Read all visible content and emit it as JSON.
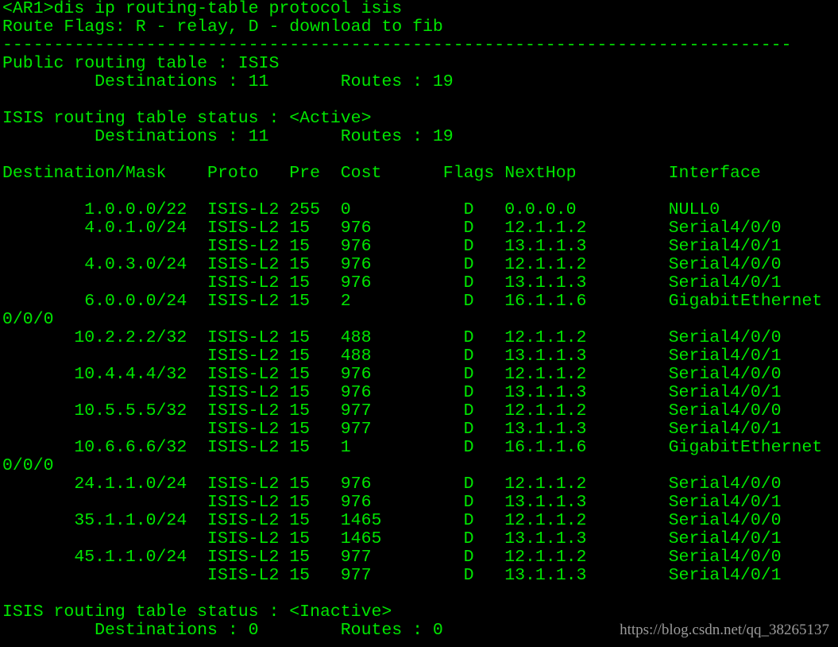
{
  "colors": {
    "background": "#000000",
    "text": "#00e600",
    "watermark": "#9a9a9a"
  },
  "terminal": {
    "lines": [
      "<AR1>dis ip routing-table protocol isis",
      "Route Flags: R - relay, D - download to fib",
      "-----------------------------------------------------------------------------",
      "Public routing table : ISIS",
      "         Destinations : 11       Routes : 19",
      "",
      "ISIS routing table status : <Active>",
      "         Destinations : 11       Routes : 19",
      "",
      "Destination/Mask    Proto   Pre  Cost      Flags NextHop         Interface",
      "",
      "        1.0.0.0/22  ISIS-L2 255  0           D   0.0.0.0         NULL0",
      "        4.0.1.0/24  ISIS-L2 15   976         D   12.1.1.2        Serial4/0/0",
      "                    ISIS-L2 15   976         D   13.1.1.3        Serial4/0/1",
      "        4.0.3.0/24  ISIS-L2 15   976         D   12.1.1.2        Serial4/0/0",
      "                    ISIS-L2 15   976         D   13.1.1.3        Serial4/0/1",
      "        6.0.0.0/24  ISIS-L2 15   2           D   16.1.1.6        GigabitEthernet",
      "0/0/0",
      "       10.2.2.2/32  ISIS-L2 15   488         D   12.1.1.2        Serial4/0/0",
      "                    ISIS-L2 15   488         D   13.1.1.3        Serial4/0/1",
      "       10.4.4.4/32  ISIS-L2 15   976         D   12.1.1.2        Serial4/0/0",
      "                    ISIS-L2 15   976         D   13.1.1.3        Serial4/0/1",
      "       10.5.5.5/32  ISIS-L2 15   977         D   12.1.1.2        Serial4/0/0",
      "                    ISIS-L2 15   977         D   13.1.1.3        Serial4/0/1",
      "       10.6.6.6/32  ISIS-L2 15   1           D   16.1.1.6        GigabitEthernet",
      "0/0/0",
      "       24.1.1.0/24  ISIS-L2 15   976         D   12.1.1.2        Serial4/0/0",
      "                    ISIS-L2 15   976         D   13.1.1.3        Serial4/0/1",
      "       35.1.1.0/24  ISIS-L2 15   1465        D   12.1.1.2        Serial4/0/0",
      "                    ISIS-L2 15   1465        D   13.1.1.3        Serial4/0/1",
      "       45.1.1.0/24  ISIS-L2 15   977         D   12.1.1.2        Serial4/0/0",
      "                    ISIS-L2 15   977         D   13.1.1.3        Serial4/0/1",
      "",
      "ISIS routing table status : <Inactive>",
      "         Destinations : 0        Routes : 0"
    ]
  },
  "watermark": "https://blog.csdn.net/qq_38265137"
}
